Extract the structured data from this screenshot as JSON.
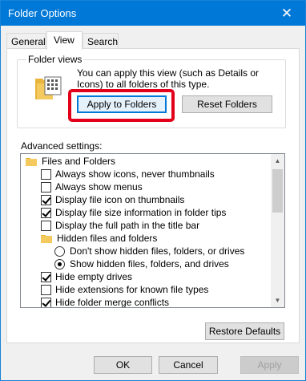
{
  "window": {
    "title": "Folder Options",
    "close_glyph": "✕"
  },
  "tabs": [
    {
      "label": "General",
      "active": false
    },
    {
      "label": "View",
      "active": true
    },
    {
      "label": "Search",
      "active": false
    }
  ],
  "folder_views": {
    "group_label": "Folder views",
    "icon": "folder-views-icon",
    "description": "You can apply this view (such as Details or Icons) to all folders of this type.",
    "apply_button": "Apply to Folders",
    "reset_button": "Reset Folders"
  },
  "advanced": {
    "label": "Advanced settings:",
    "items": [
      {
        "type": "folder",
        "label": "Files and Folders",
        "indent": 0
      },
      {
        "type": "checkbox",
        "label": "Always show icons, never thumbnails",
        "checked": false,
        "indent": 1
      },
      {
        "type": "checkbox",
        "label": "Always show menus",
        "checked": false,
        "indent": 1
      },
      {
        "type": "checkbox",
        "label": "Display file icon on thumbnails",
        "checked": true,
        "indent": 1
      },
      {
        "type": "checkbox",
        "label": "Display file size information in folder tips",
        "checked": true,
        "indent": 1
      },
      {
        "type": "checkbox",
        "label": "Display the full path in the title bar",
        "checked": false,
        "indent": 1
      },
      {
        "type": "folder",
        "label": "Hidden files and folders",
        "indent": 1
      },
      {
        "type": "radio",
        "label": "Don't show hidden files, folders, or drives",
        "checked": false,
        "indent": 2
      },
      {
        "type": "radio",
        "label": "Show hidden files, folders, and drives",
        "checked": true,
        "indent": 2
      },
      {
        "type": "checkbox",
        "label": "Hide empty drives",
        "checked": true,
        "indent": 1
      },
      {
        "type": "checkbox",
        "label": "Hide extensions for known file types",
        "checked": false,
        "indent": 1
      },
      {
        "type": "checkbox",
        "label": "Hide folder merge conflicts",
        "checked": true,
        "indent": 1
      }
    ],
    "restore_button": "Restore Defaults"
  },
  "footer": {
    "ok": "OK",
    "cancel": "Cancel",
    "apply": "Apply"
  },
  "colors": {
    "titlebar": "#0078d7",
    "highlight_outline": "#e3001b",
    "folder": "#f4c95d"
  }
}
